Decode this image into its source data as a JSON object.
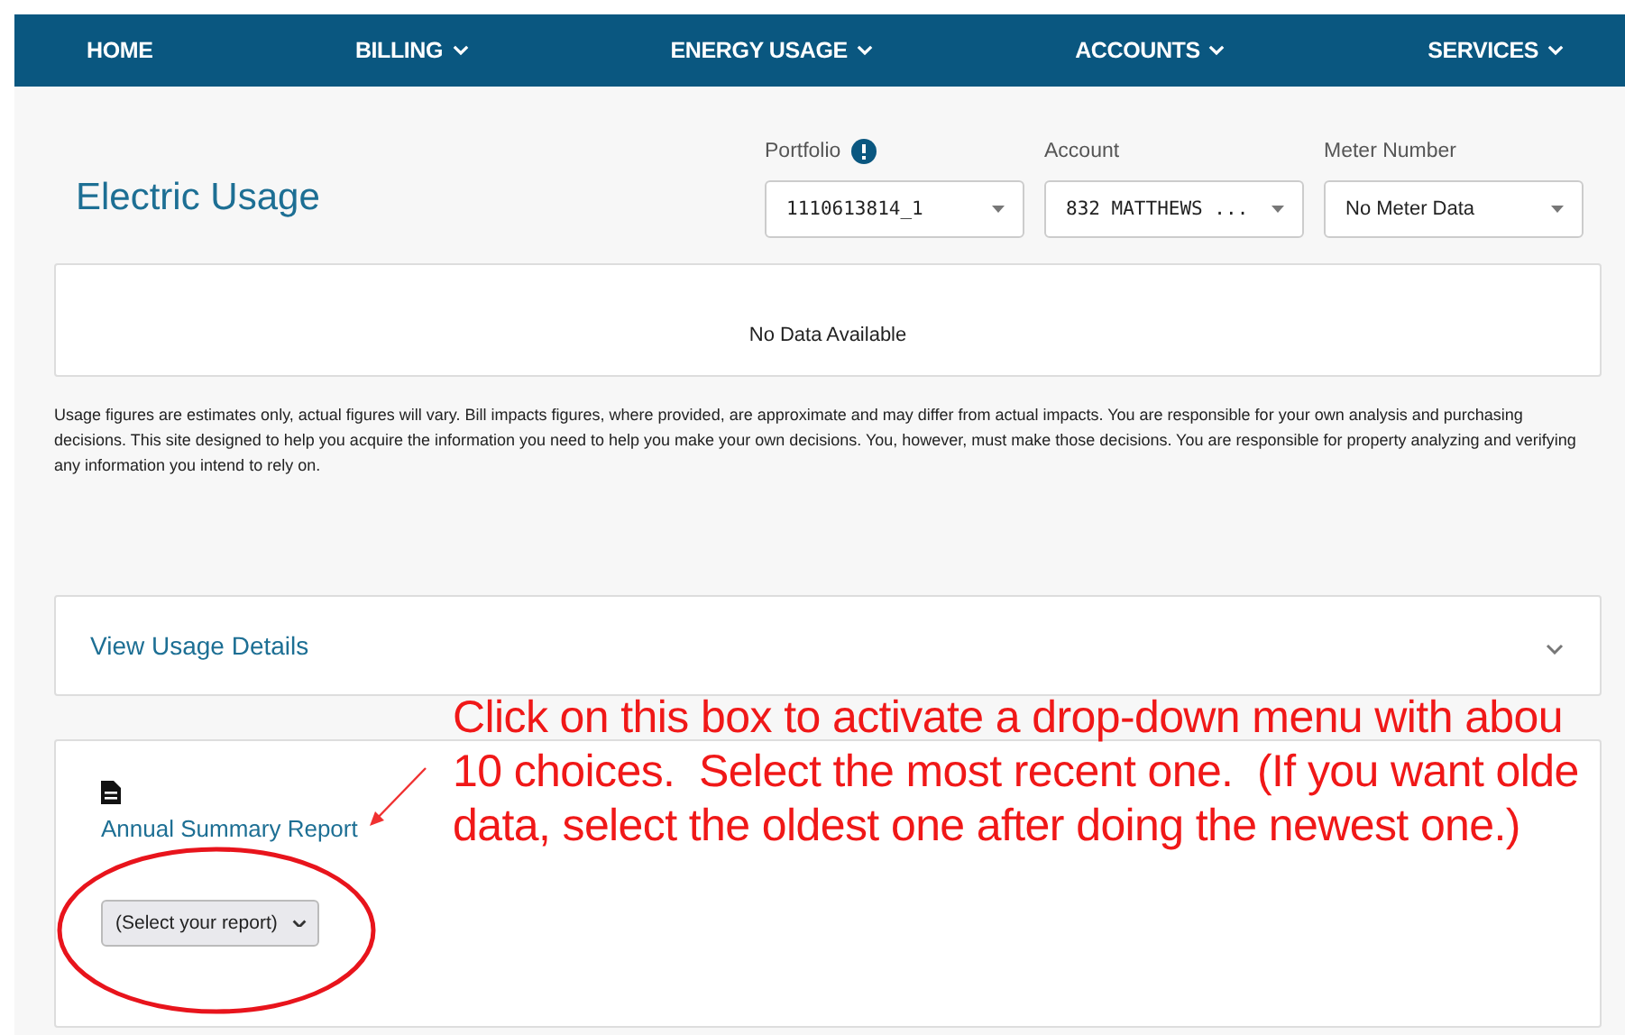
{
  "nav": [
    {
      "label": "HOME",
      "has_menu": false
    },
    {
      "label": "BILLING",
      "has_menu": true
    },
    {
      "label": "ENERGY USAGE",
      "has_menu": true
    },
    {
      "label": "ACCOUNTS",
      "has_menu": true
    },
    {
      "label": "SERVICES",
      "has_menu": true
    }
  ],
  "page_title": "Electric Usage",
  "selectors": [
    {
      "label": "Portfolio",
      "value": "1110613814_1",
      "info": true,
      "kind": "mono"
    },
    {
      "label": "Account",
      "value": "832 MATTHEWS ...",
      "info": false,
      "kind": "mono"
    },
    {
      "label": "Meter Number",
      "value": "No Meter Data",
      "info": false,
      "kind": "plain"
    }
  ],
  "chart_panel": {
    "message": "No Data Available"
  },
  "disclaimer": "Usage figures are estimates only, actual figures will vary. Bill impacts figures, where provided, are approximate and may differ from actual impacts. You are responsible for your own analysis and purchasing decisions. This site designed to help you acquire the information you need to help you make your own decisions. You, however, must make those decisions. You are responsible for property analyzing and verifying any information you intend to rely on.",
  "usage_details": {
    "title": "View Usage Details",
    "expanded": false
  },
  "report": {
    "link": "Annual Summary Report",
    "select": "(Select your report)"
  },
  "annotation": {
    "lines": [
      "Click on this box to activate a drop-down menu with abou",
      "10 choices.  Select the most recent one.  (If you want olde",
      "data, select the oldest one after doing the newest one.)"
    ]
  }
}
